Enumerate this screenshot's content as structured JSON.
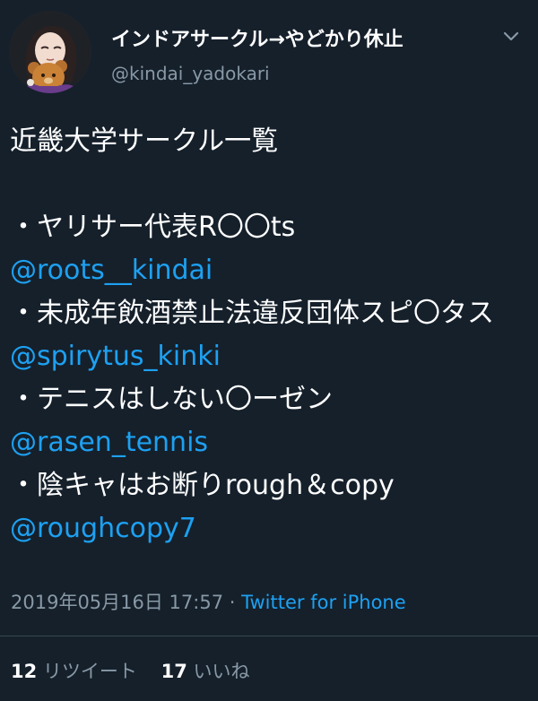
{
  "header": {
    "display_name": "インドアサークル→やどかり休止",
    "username": "@kindai_yadokari"
  },
  "tweet": {
    "title": "近畿大学サークル一覧",
    "entries": [
      {
        "text": "・ヤリサー代表R〇〇ts",
        "handle": "@roots__kindai"
      },
      {
        "text": "・未成年飲酒禁止法違反団体スピ〇タス",
        "handle": "@spirytus_kinki"
      },
      {
        "text": "・テニスはしない〇ーゼン",
        "handle": "@rasen_tennis"
      },
      {
        "text": "・陰キャはお断りrough＆copy",
        "handle": "@roughcopy7"
      }
    ]
  },
  "meta": {
    "timestamp": "2019年05月16日 17:57",
    "separator": "·",
    "source": "Twitter for iPhone"
  },
  "stats": {
    "retweet_count": "12",
    "retweet_label": "リツイート",
    "like_count": "17",
    "like_label": "いいね"
  },
  "colors": {
    "background": "#15202b",
    "text": "#ffffff",
    "secondary": "#8899a6",
    "link": "#1da1f2"
  },
  "icons": {
    "caret": "chevron-down-icon",
    "avatar": "avatar-illustration"
  }
}
